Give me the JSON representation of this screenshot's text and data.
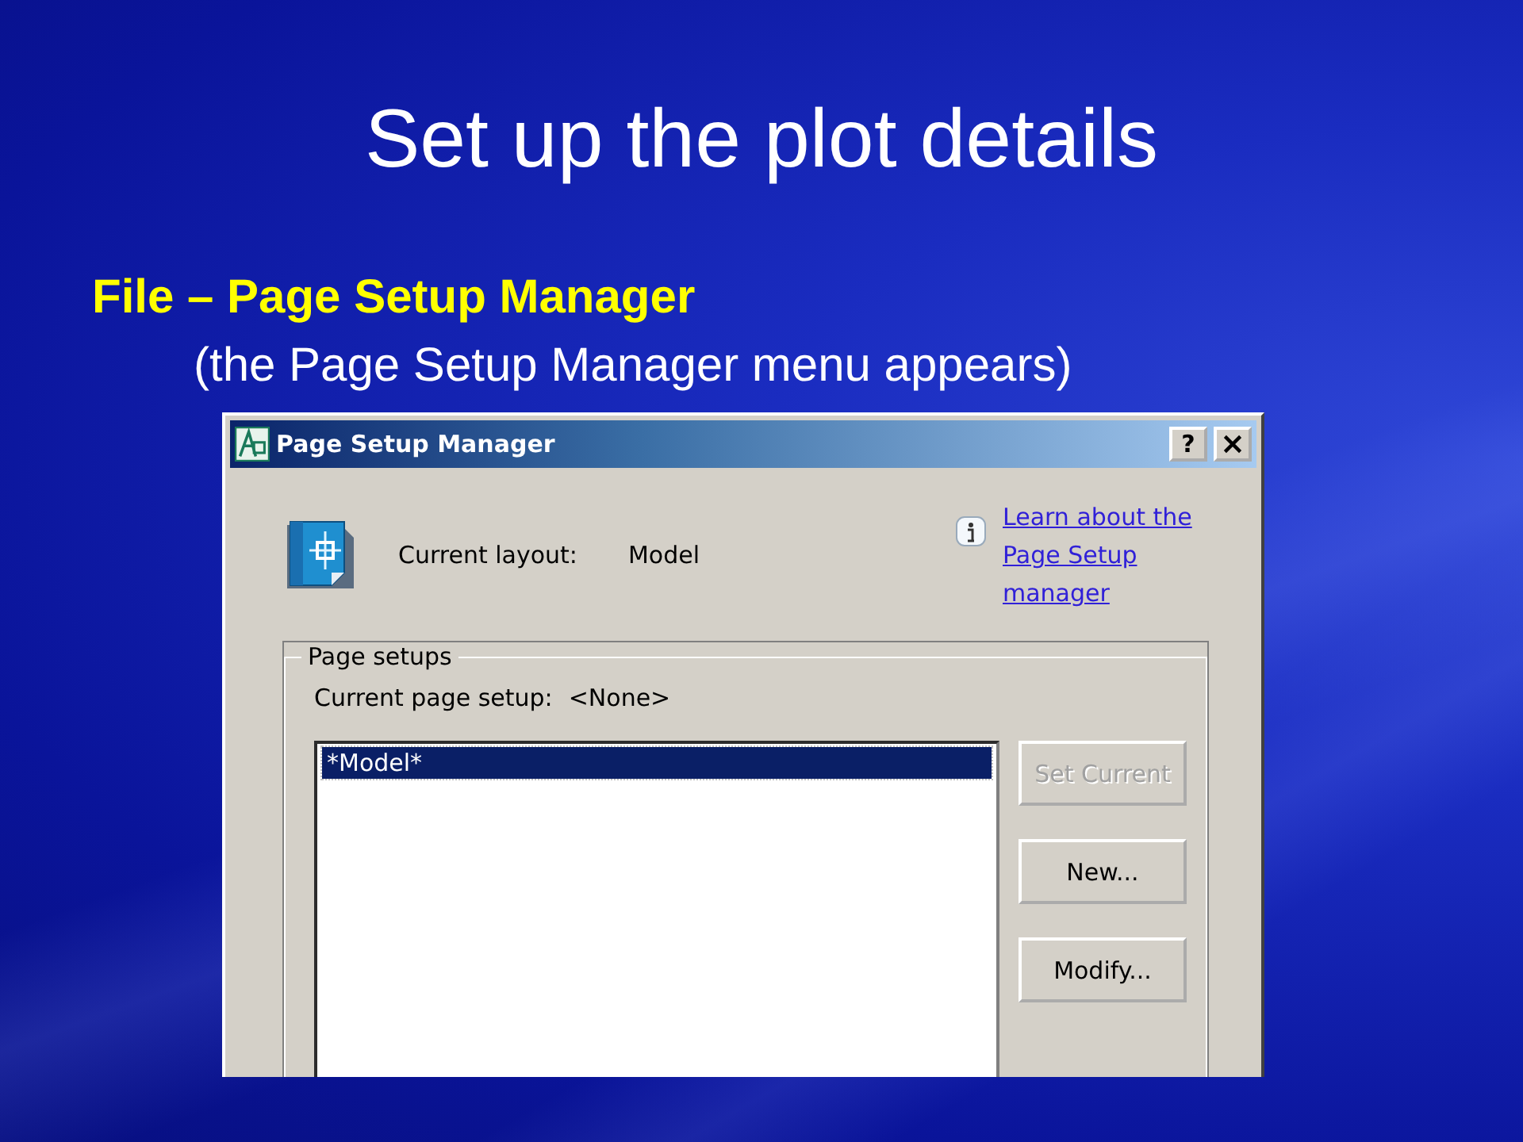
{
  "slide": {
    "title": "Set up the plot details",
    "bullet": "File – Page Setup Manager",
    "sub_bullet": "(the Page Setup Manager menu appears)"
  },
  "dialog": {
    "title": "Page Setup Manager",
    "help_button": "?",
    "current_layout_label": "Current layout:",
    "current_layout_value": "Model",
    "help_link": "Learn about the Page Setup manager",
    "group": {
      "legend": "Page setups",
      "current_setup_label": "Current page setup:",
      "current_setup_value": "<None>",
      "items": [
        {
          "label": "*Model*",
          "selected": true
        }
      ],
      "buttons": [
        {
          "label": "Set Current",
          "disabled": true
        },
        {
          "label": "New...",
          "disabled": false
        },
        {
          "label": "Modify...",
          "disabled": false
        }
      ]
    }
  }
}
